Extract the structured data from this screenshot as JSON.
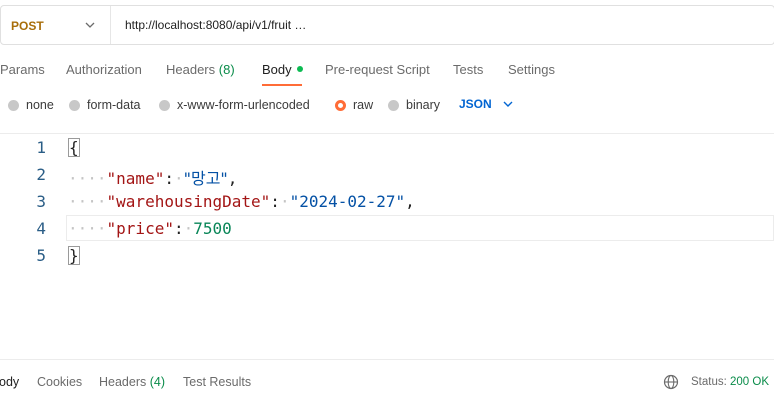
{
  "request": {
    "method": "POST",
    "url": "http://localhost:8080/api/v1/fruit …"
  },
  "tabs": [
    {
      "label": "Params"
    },
    {
      "label": "Authorization"
    },
    {
      "label": "Headers",
      "count": "(8)"
    },
    {
      "label": "Body"
    },
    {
      "label": "Pre-request Script"
    },
    {
      "label": "Tests"
    },
    {
      "label": "Settings"
    }
  ],
  "active_tab": "Body",
  "body_types": [
    {
      "label": "none"
    },
    {
      "label": "form-data"
    },
    {
      "label": "x-www-form-urlencoded"
    },
    {
      "label": "raw"
    },
    {
      "label": "binary"
    }
  ],
  "selected_body_type": "raw",
  "format": "JSON",
  "editor": {
    "line_numbers": [
      "1",
      "2",
      "3",
      "4",
      "5"
    ],
    "open_brace": "{",
    "close_brace": "}",
    "fields": [
      {
        "key": "\"name\"",
        "value": "\"망고\"",
        "trailing": ","
      },
      {
        "key": "\"warehousingDate\"",
        "value": "\"2024-02-27\"",
        "trailing": ","
      },
      {
        "key": "\"price\"",
        "value": "7500",
        "trailing": ""
      }
    ]
  },
  "response": {
    "tabs": [
      {
        "label": "ody"
      },
      {
        "label": "Cookies"
      },
      {
        "label": "Headers",
        "count": "(4)"
      },
      {
        "label": "Test Results"
      }
    ],
    "status_label": "Status:",
    "status_value": "200 OK"
  },
  "colors": {
    "accent": "#ff6c37",
    "method": "#a86e0a",
    "json_select": "#0265d2",
    "success": "#0a8c4a"
  }
}
